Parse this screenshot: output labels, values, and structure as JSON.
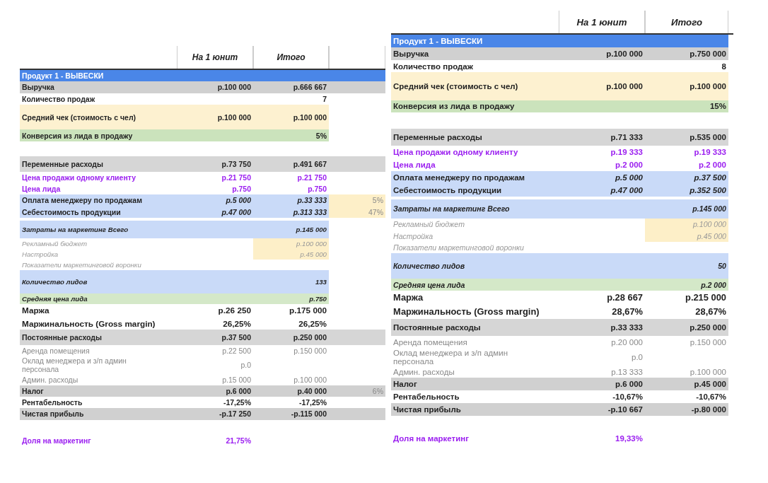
{
  "panels": [
    {
      "headers": [
        "На 1 юнит",
        "Итого"
      ],
      "extra_column": true,
      "rows": [
        {
          "kind": "section",
          "label": "Продукт 1 - ВЫВЕСКИ"
        },
        {
          "kind": "gray",
          "label": "Выручка",
          "unit": "р.100 000",
          "total": "р.666 667"
        },
        {
          "kind": "plain",
          "label": "Количество продаж",
          "total": "7"
        },
        {
          "kind": "check",
          "label": "Средний чек (стоимость с чел)",
          "unit": "р.100 000",
          "total": "р.100 000"
        },
        {
          "kind": "conversion",
          "label": "Конверсия из лида в продажу",
          "total": "5%"
        },
        {
          "kind": "gap"
        },
        {
          "kind": "subtotal",
          "label": "Переменные расходы",
          "unit": "р.73 750",
          "total": "р.491 667"
        },
        {
          "kind": "accent",
          "label": "Цена продажи одному клиенту",
          "unit": "р.21 750",
          "total": "р.21 750"
        },
        {
          "kind": "accent",
          "label": "Цена лида",
          "unit": "р.750",
          "total": "р.750"
        },
        {
          "kind": "cost",
          "label": "Оплата менеджеру по продажам",
          "unit": "р.5 000",
          "total": "р.33 333",
          "extra": "5%"
        },
        {
          "kind": "cost",
          "label": "Себестоимость продукции",
          "unit": "р.47 000",
          "total": "р.313 333",
          "extra": "47%"
        },
        {
          "kind": "marketing",
          "label": "Затраты на маркетинг Всего",
          "total": "р.145 000"
        },
        {
          "kind": "budget",
          "label": "Рекламный бюджет",
          "total": "р.100 000"
        },
        {
          "kind": "budget",
          "label": "Настройка",
          "total": "р.45 000"
        },
        {
          "kind": "note",
          "label": "Показатели маркетинговой воронки"
        },
        {
          "kind": "leads",
          "label": "Количество лидов",
          "total": "133"
        },
        {
          "kind": "lead-price",
          "label": "Средняя цена лида",
          "total": "р.750"
        },
        {
          "kind": "margin",
          "label": "Маржа",
          "unit": "р.26 250",
          "total": "р.175 000"
        },
        {
          "kind": "margin",
          "label": "Маржинальность (Gross margin)",
          "unit": "26,25%",
          "total": "26,25%"
        },
        {
          "kind": "subtotal",
          "label": "Постоянные расходы",
          "unit": "р.37 500",
          "total": "р.250 000"
        },
        {
          "kind": "detail",
          "label": "Аренда помещения",
          "unit": "р.22 500",
          "total": "р.150 000"
        },
        {
          "kind": "detail",
          "label": "Оклад менеджера и з/п админ персонала",
          "unit": "р.0"
        },
        {
          "kind": "detail",
          "label": "Админ. расходы",
          "unit": "р.15 000",
          "total": "р.100 000"
        },
        {
          "kind": "gray",
          "label": "Налог",
          "unit": "р.6 000",
          "total": "р.40 000",
          "extra": "6%"
        },
        {
          "kind": "plain",
          "label": "Рентабельность",
          "unit": "-17,25%",
          "total": "-17,25%"
        },
        {
          "kind": "gray",
          "label": "Чистая прибыль",
          "unit": "-р.17 250",
          "total": "-р.115 000"
        },
        {
          "kind": "gap"
        },
        {
          "kind": "accent",
          "label": "Доля на маркетинг",
          "unit": "21,75%"
        }
      ]
    },
    {
      "headers": [
        "На 1 юнит",
        "Итого"
      ],
      "extra_column": false,
      "rows": [
        {
          "kind": "section",
          "label": "Продукт 1 - ВЫВЕСКИ"
        },
        {
          "kind": "gray",
          "label": "Выручка",
          "unit": "р.100 000",
          "total": "р.750 000"
        },
        {
          "kind": "plain",
          "label": "Количество продаж",
          "total": "8"
        },
        {
          "kind": "check",
          "label": "Средний чек (стоимость с чел)",
          "unit": "р.100 000",
          "total": "р.100 000"
        },
        {
          "kind": "conversion",
          "label": "Конверсия из лида в продажу",
          "total": "15%"
        },
        {
          "kind": "gap"
        },
        {
          "kind": "subtotal",
          "label": "Переменные расходы",
          "unit": "р.71 333",
          "total": "р.535 000"
        },
        {
          "kind": "accent",
          "label": "Цена продажи одному клиенту",
          "unit": "р.19 333",
          "total": "р.19 333"
        },
        {
          "kind": "accent",
          "label": "Цена лида",
          "unit": "р.2 000",
          "total": "р.2 000"
        },
        {
          "kind": "cost",
          "label": "Оплата менеджеру по продажам",
          "unit": "р.5 000",
          "total": "р.37 500"
        },
        {
          "kind": "cost",
          "label": "Себестоимость продукции",
          "unit": "р.47 000",
          "total": "р.352 500"
        },
        {
          "kind": "marketing",
          "label": "Затраты на маркетинг Всего",
          "total": "р.145 000"
        },
        {
          "kind": "budget",
          "label": "Рекламный бюджет",
          "total": "р.100 000"
        },
        {
          "kind": "budget",
          "label": "Настройка",
          "total": "р.45 000"
        },
        {
          "kind": "note",
          "label": "Показатели маркетинговой воронки"
        },
        {
          "kind": "leads",
          "label": "Количество лидов",
          "total": "50"
        },
        {
          "kind": "lead-price",
          "label": "Средняя цена лида",
          "total": "р.2 000"
        },
        {
          "kind": "margin",
          "label": "Маржа",
          "unit": "р.28 667",
          "total": "р.215 000"
        },
        {
          "kind": "margin",
          "label": "Маржинальность (Gross margin)",
          "unit": "28,67%",
          "total": "28,67%"
        },
        {
          "kind": "subtotal",
          "label": "Постоянные расходы",
          "unit": "р.33 333",
          "total": "р.250 000"
        },
        {
          "kind": "detail",
          "label": "Аренда помещения",
          "unit": "р.20 000",
          "total": "р.150 000"
        },
        {
          "kind": "detail",
          "label": "Оклад менеджера и з/п админ персонала",
          "unit": "р.0"
        },
        {
          "kind": "detail",
          "label": "Админ. расходы",
          "unit": "р.13 333",
          "total": "р.100 000"
        },
        {
          "kind": "gray",
          "label": "Налог",
          "unit": "р.6 000",
          "total": "р.45 000"
        },
        {
          "kind": "plain",
          "label": "Рентабельность",
          "unit": "-10,67%",
          "total": "-10,67%"
        },
        {
          "kind": "gray",
          "label": "Чистая прибыль",
          "unit": "-р.10 667",
          "total": "-р.80 000"
        },
        {
          "kind": "gap"
        },
        {
          "kind": "accent",
          "label": "Доля на маркетинг",
          "unit": "19,33%"
        }
      ]
    }
  ]
}
